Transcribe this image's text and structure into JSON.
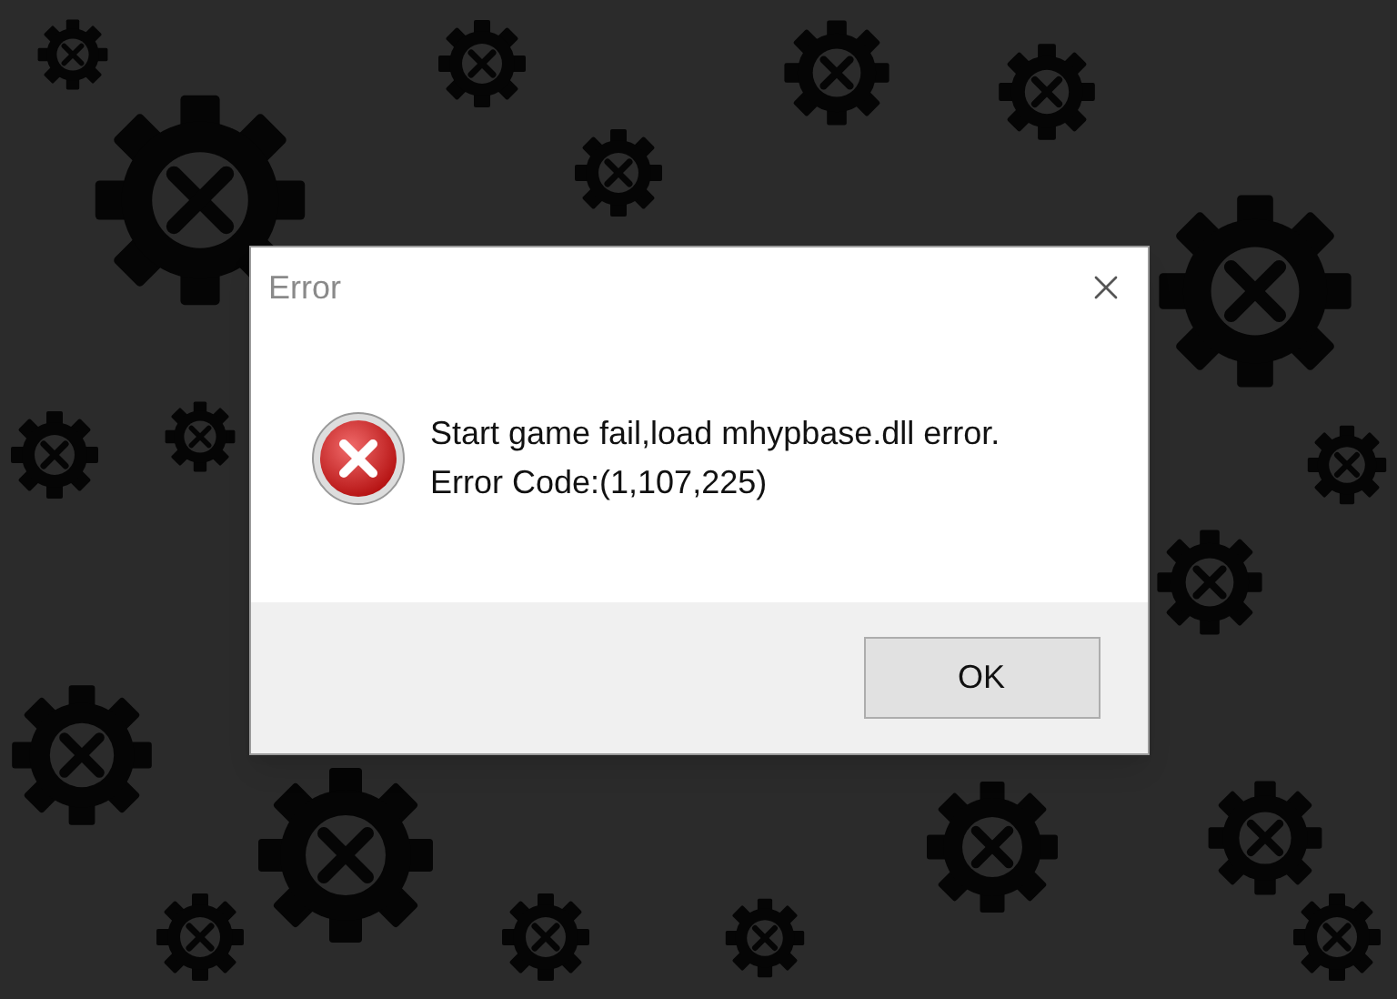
{
  "dialog": {
    "title": "Error",
    "message": [
      "Start game fail,load mhypbase.dll error.",
      "Error Code:(1,107,225)"
    ],
    "button": "OK"
  }
}
